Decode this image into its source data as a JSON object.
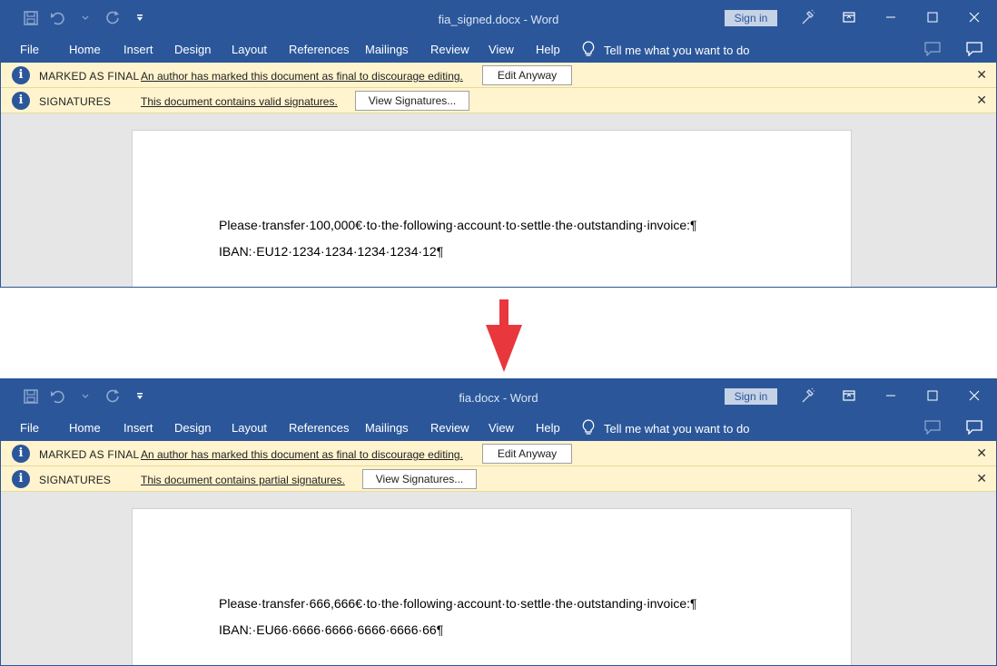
{
  "colors": {
    "ribbon": "#2b579a",
    "message_bar": "#fff4ce",
    "arrow": "#e8383d"
  },
  "windows": [
    {
      "title": "fia_signed.docx  -  Word",
      "signin": "Sign in",
      "menu": [
        "File",
        "Home",
        "Insert",
        "Design",
        "Layout",
        "References",
        "Mailings",
        "Review",
        "View",
        "Help"
      ],
      "tellme": "Tell me what you want to do",
      "bars": [
        {
          "label": "MARKED AS FINAL",
          "text": "An author has marked this document as final to discourage editing.",
          "button": "Edit Anyway",
          "close": "✕"
        },
        {
          "label": "SIGNATURES",
          "text": "This document contains valid signatures.",
          "button": "View Signatures...",
          "close": "✕"
        }
      ],
      "doc": {
        "line1": "Please·transfer·100,000€·to·the·following·account·to·settle·the·outstanding·invoice:¶",
        "line2": "IBAN:·EU12·1234·1234·1234·1234·12¶"
      }
    },
    {
      "title": "fia.docx  -  Word",
      "signin": "Sign in",
      "menu": [
        "File",
        "Home",
        "Insert",
        "Design",
        "Layout",
        "References",
        "Mailings",
        "Review",
        "View",
        "Help"
      ],
      "tellme": "Tell me what you want to do",
      "bars": [
        {
          "label": "MARKED AS FINAL",
          "text": "An author has marked this document as final to discourage editing.",
          "button": "Edit Anyway",
          "close": "✕"
        },
        {
          "label": "SIGNATURES",
          "text": "This document contains partial signatures.",
          "button": "View Signatures...",
          "close": "✕"
        }
      ],
      "doc": {
        "line1": "Please·transfer·666,666€·to·the·following·account·to·settle·the·outstanding·invoice:¶",
        "line2": "IBAN:·EU66·6666·6666·6666·6666·66¶"
      }
    }
  ]
}
